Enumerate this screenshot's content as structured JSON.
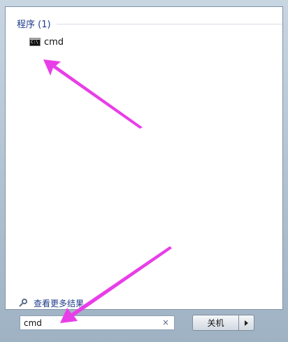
{
  "results": {
    "group_title": "程序 (1)",
    "items": [
      {
        "label": "cmd",
        "icon": "cmd-icon"
      }
    ]
  },
  "see_more": {
    "label": "查看更多结果",
    "icon": "magnifier-icon"
  },
  "search": {
    "value": "cmd",
    "clear_icon": "×"
  },
  "shutdown": {
    "label": "关机",
    "arrow_icon": "arrow-right-icon"
  },
  "colors": {
    "annotation_arrow": "#e83ee8",
    "group_title": "#1e3b8a"
  }
}
